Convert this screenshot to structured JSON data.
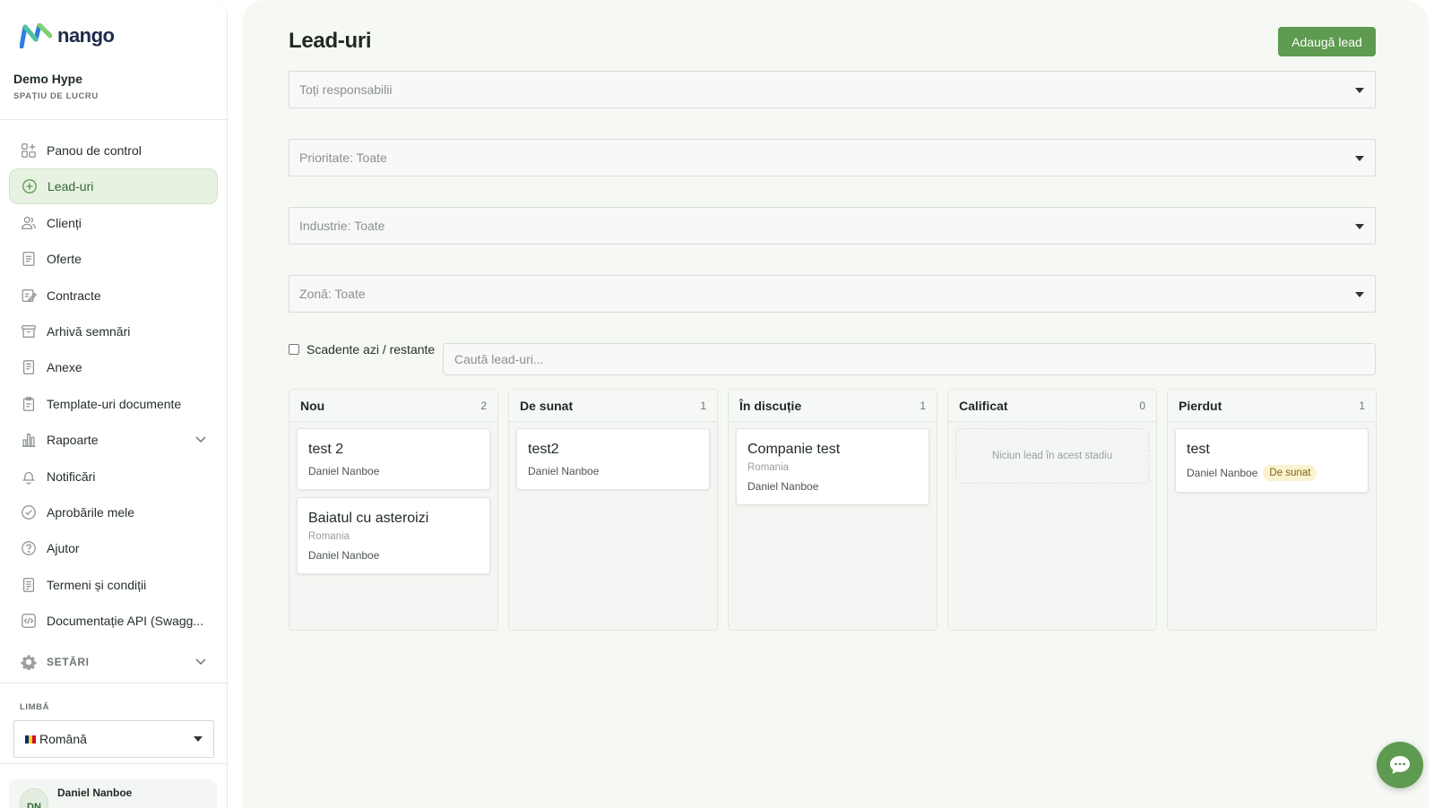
{
  "app": {
    "logo_text": "nango"
  },
  "workspace": {
    "name": "Demo Hype",
    "label": "SPAȚIU DE LUCRU"
  },
  "nav": {
    "items": [
      {
        "label": "Panou de control",
        "icon": "dashboard-icon"
      },
      {
        "label": "Lead-uri",
        "icon": "plus-circle-icon",
        "active": true
      },
      {
        "label": "Clienți",
        "icon": "users-icon"
      },
      {
        "label": "Oferte",
        "icon": "document-icon"
      },
      {
        "label": "Contracte",
        "icon": "contract-edit-icon"
      },
      {
        "label": "Arhivă semnări",
        "icon": "archive-icon"
      },
      {
        "label": "Anexe",
        "icon": "attachment-doc-icon"
      },
      {
        "label": "Template-uri documente",
        "icon": "clipboard-icon"
      },
      {
        "label": "Rapoarte",
        "icon": "bar-chart-icon"
      },
      {
        "label": "Notificări",
        "icon": "bell-icon"
      },
      {
        "label": "Aprobările mele",
        "icon": "check-circle-icon"
      },
      {
        "label": "Ajutor",
        "icon": "help-circle-icon"
      },
      {
        "label": "Termeni și condiții",
        "icon": "terms-doc-icon"
      },
      {
        "label": "Documentație API (Swagg...",
        "icon": "code-icon"
      }
    ],
    "settings_label": "SETĂRI"
  },
  "language": {
    "label": "LIMBĂ",
    "selected": "Română",
    "flag_colors": [
      "#002B7F",
      "#FCD116",
      "#CE1126"
    ]
  },
  "user": {
    "initials": "DN",
    "name": "Daniel Nanboe"
  },
  "page": {
    "title": "Lead-uri",
    "add_button": "Adaugă lead",
    "filters": {
      "owner": "Toți responsabilii",
      "priority": "Prioritate: Toate",
      "industry": "Industrie: Toate",
      "zone": "Zonă: Toate"
    },
    "due_checkbox_label": "Scadente azi / restante",
    "search_placeholder": "Caută lead-uri..."
  },
  "board": {
    "columns": [
      {
        "title": "Nou",
        "count": "2",
        "cards": [
          {
            "title": "test 2",
            "zone": "",
            "owner": "Daniel Nanboe",
            "badge": ""
          },
          {
            "title": "Baiatul cu asteroizi",
            "zone": "Romania",
            "owner": "Daniel Nanboe",
            "badge": ""
          }
        ]
      },
      {
        "title": "De sunat",
        "count": "1",
        "cards": [
          {
            "title": "test2",
            "zone": "",
            "owner": "Daniel Nanboe",
            "badge": ""
          }
        ]
      },
      {
        "title": "În discuție",
        "count": "1",
        "cards": [
          {
            "title": "Companie test",
            "zone": "Romania",
            "owner": "Daniel Nanboe",
            "badge": ""
          }
        ]
      },
      {
        "title": "Calificat",
        "count": "0",
        "cards": [],
        "empty_text": "Niciun lead în acest stadiu"
      },
      {
        "title": "Pierdut",
        "count": "1",
        "cards": [
          {
            "title": "test",
            "zone": "",
            "owner": "Daniel Nanboe",
            "badge": "De sunat"
          }
        ]
      }
    ]
  },
  "colors": {
    "accent": "#5e9a50",
    "active_bg": "#e7f2e3",
    "badge_bg": "#fbf2cf"
  }
}
